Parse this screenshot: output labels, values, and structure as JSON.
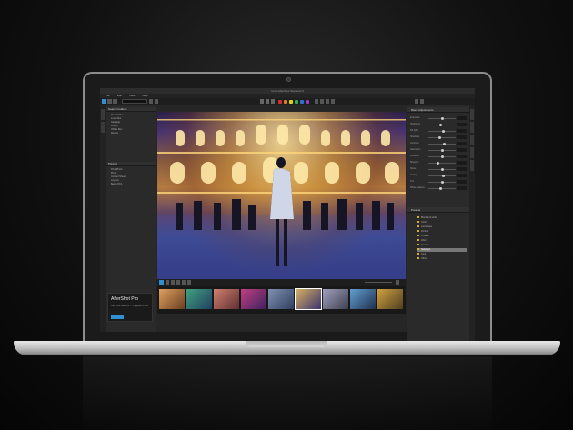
{
  "app": {
    "window_title": "Corel AfterShot Standard 3"
  },
  "menu": {
    "items": [
      "File",
      "Edit",
      "View",
      "Help"
    ]
  },
  "left_panel": {
    "browse_header": "Search Folders",
    "browse_items": [
      "Recent files",
      "Local files",
      "Catalogs",
      "Library",
      "Offline files",
      "Recent"
    ],
    "output_header": "Printing",
    "output_items": [
      "Print Photo",
      "Print",
      "Contact Sheet",
      "Layouts",
      "Batch Print"
    ]
  },
  "promo": {
    "title": "AfterShot Pro",
    "text": "Get more features — Upgrade to Pro"
  },
  "right_panel": {
    "header": "Basic Adjustments",
    "sliders": [
      {
        "label": "Exposure",
        "value": 0.5
      },
      {
        "label": "Highlights",
        "value": 0.45
      },
      {
        "label": "Fill light",
        "value": 0.55
      },
      {
        "label": "Shadows",
        "value": 0.4
      },
      {
        "label": "Contrast",
        "value": 0.6
      },
      {
        "label": "Saturation",
        "value": 0.5
      },
      {
        "label": "Vibrance",
        "value": 0.5
      },
      {
        "label": "Sharpen",
        "value": 0.35
      },
      {
        "label": "Noise",
        "value": 0.5
      },
      {
        "label": "Clarity",
        "value": 0.55
      },
      {
        "label": "Tint",
        "value": 0.5
      },
      {
        "label": "White balance",
        "value": 0.45
      }
    ],
    "presets_header": "Presets",
    "presets": [
      "Black and white",
      "Color",
      "Landscape",
      "Portrait",
      "Vintage",
      "Warm",
      "Custom",
      "Selected",
      "Cool",
      "Other"
    ],
    "presets_selected_index": 7
  },
  "colors": {
    "accent": "#2f8fd0",
    "label_colors": [
      "#d03030",
      "#e08020",
      "#e0d020",
      "#30b040",
      "#3070d0",
      "#9040c0"
    ]
  }
}
